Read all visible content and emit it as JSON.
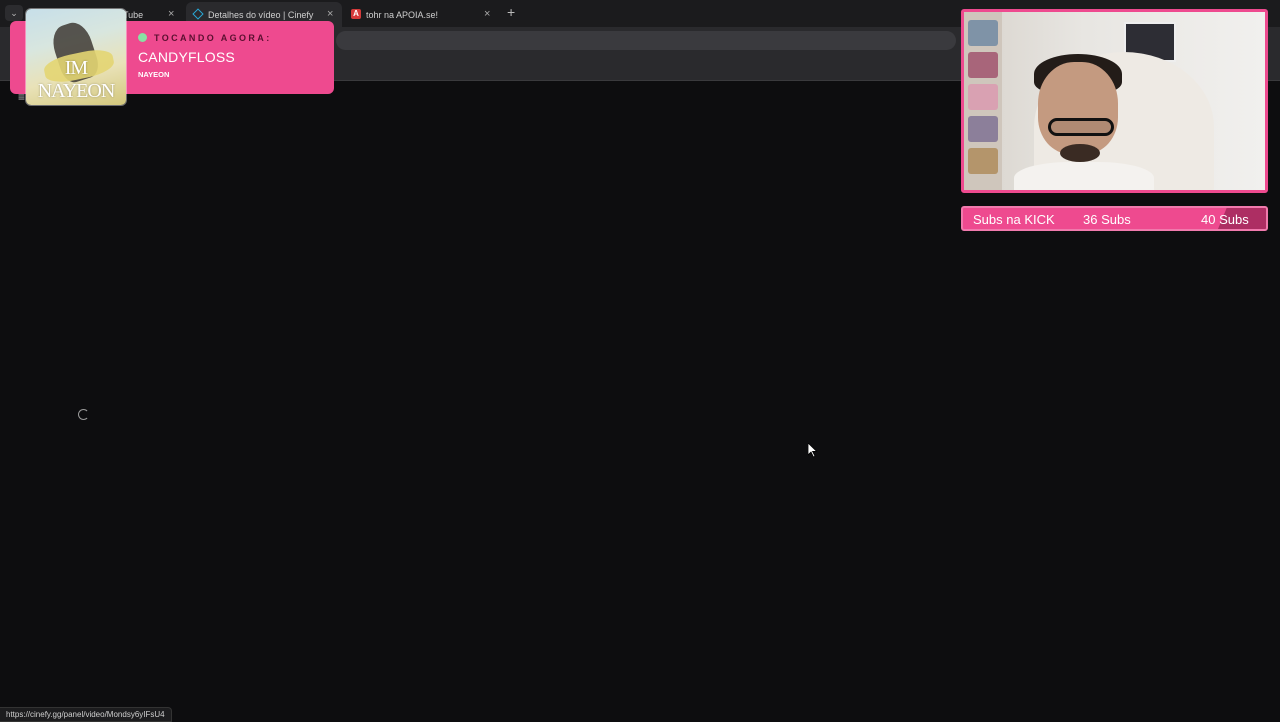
{
  "browser": {
    "tabs": [
      {
        "label": "Tube",
        "close": "×"
      },
      {
        "label": "Detalhes do vídeo | Cinefy",
        "close": "×"
      },
      {
        "label": "tohr na APOIA.se!",
        "close": "×"
      }
    ],
    "new_tab": "+",
    "tab_menu": "⌄",
    "status_url": "https://cinefy.gg/panel/video/Mondsy6yIFsU4"
  },
  "page": {
    "menu_icon": "≡"
  },
  "now_playing": {
    "heading": "TOCANDO AGORA:",
    "title": "CANDYFLOSS",
    "artist": "NAYEON",
    "album_art_text": "IM NAYEON",
    "accent": "#ee4a8f"
  },
  "subs_goal": {
    "label": "Subs na KICK",
    "current": "36 Subs",
    "goal": "40 Subs",
    "progress": 0.9
  },
  "colors": {
    "background": "#0d0d0f",
    "overlay_pink": "#ee4a8f"
  }
}
